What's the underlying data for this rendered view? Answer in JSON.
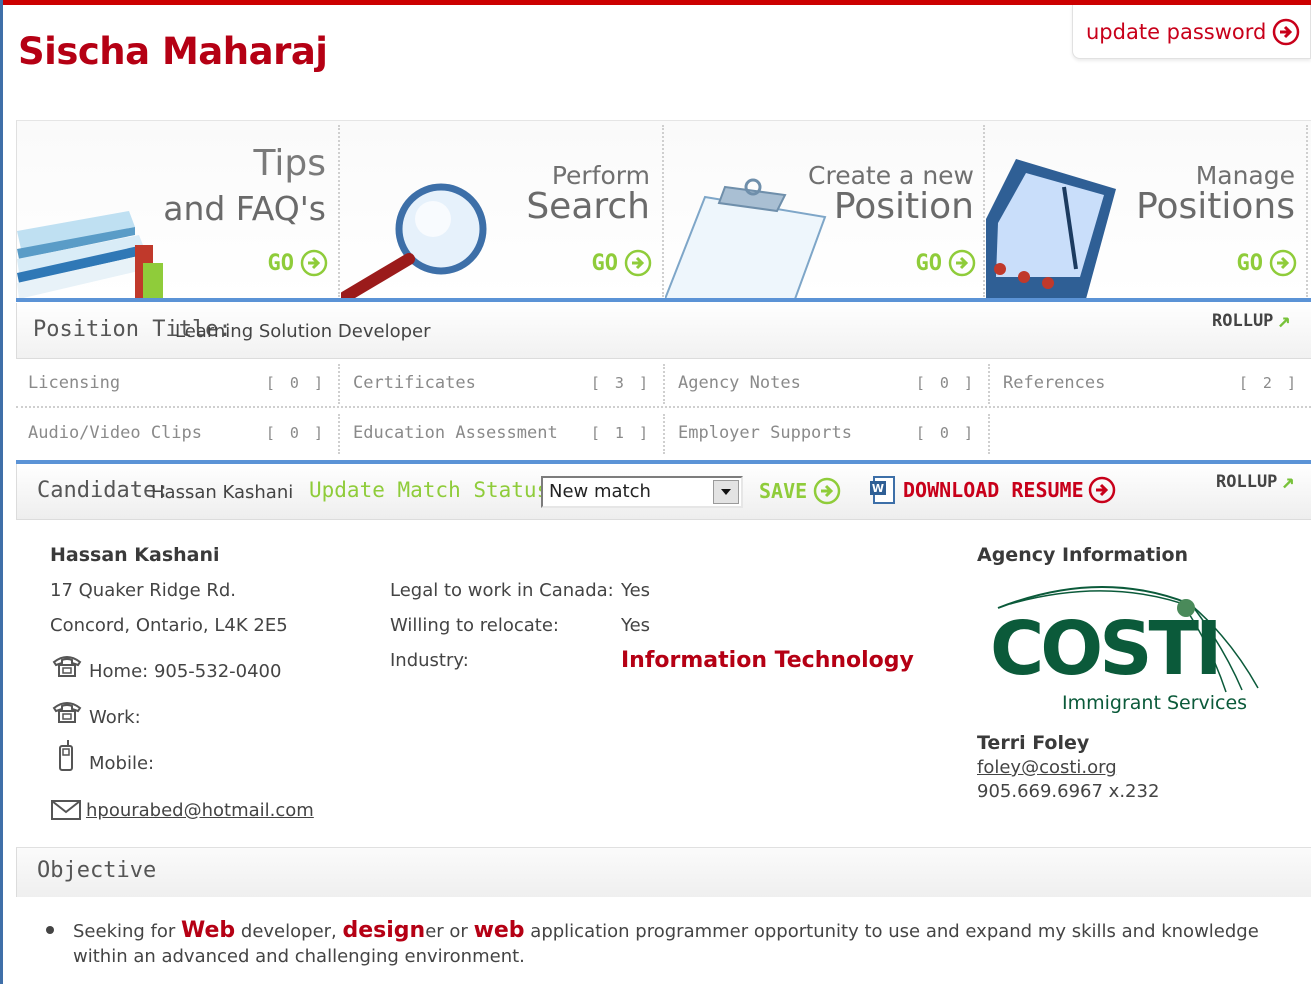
{
  "header": {
    "user_name": "Sischa Maharaj",
    "update_password": "update password"
  },
  "banner": {
    "tiles": [
      {
        "small": "Tips",
        "big": "and FAQ's",
        "go": "GO"
      },
      {
        "small": "Perform",
        "big": "Search",
        "go": "GO"
      },
      {
        "small": "Create a new",
        "big": "Position",
        "go": "GO"
      },
      {
        "small": "Manage",
        "big": "Positions",
        "go": "GO"
      }
    ]
  },
  "position": {
    "label": "Position Title:",
    "value": "Learning Solution Developer",
    "rollup": "ROLLUP"
  },
  "sections": {
    "row1": [
      {
        "label": "Licensing",
        "count": "[ 0 ]"
      },
      {
        "label": "Certificates",
        "count": "[ 3 ]"
      },
      {
        "label": "Agency Notes",
        "count": "[ 0 ]"
      },
      {
        "label": "References",
        "count": "[ 2 ]"
      }
    ],
    "row2": [
      {
        "label": "Audio/Video Clips",
        "count": "[ 0 ]"
      },
      {
        "label": "Education Assessment",
        "count": "[ 1 ]"
      },
      {
        "label": "Employer Supports",
        "count": "[ 0 ]"
      }
    ]
  },
  "candidate_bar": {
    "label": "Candidate:",
    "name": "Hassan Kashani",
    "update_status_label": "Update Match Status:",
    "status_selected": "New match",
    "save": "SAVE",
    "download_resume": "DOWNLOAD RESUME",
    "rollup": "ROLLUP"
  },
  "candidate": {
    "name": "Hassan Kashani",
    "address1": "17 Quaker Ridge Rd.",
    "address2": "Concord, Ontario, L4K 2E5",
    "home": "Home: 905-532-0400",
    "work": "Work:",
    "mobile": "Mobile:",
    "email": "hpourabed@hotmail.com",
    "legal_label": "Legal to work in Canada:",
    "legal_value": "Yes",
    "relocate_label": "Willing to relocate:",
    "relocate_value": "Yes",
    "industry_label": "Industry:",
    "industry_value": "Information Technology"
  },
  "agency": {
    "heading": "Agency Information",
    "logo_text": "COSTI",
    "logo_sub": "Immigrant Services",
    "contact_name": "Terri Foley",
    "contact_email": "foley@costi.org",
    "contact_phone": "905.669.6967 x.232"
  },
  "objective": {
    "heading": "Objective",
    "p1": "Seeking for ",
    "h1": "Web",
    "p2": " developer, ",
    "h2": "design",
    "p3": "er or ",
    "h3": "web",
    "p4": " application programmer opportunity to use and expand my skills and knowledge within an advanced and challenging environment."
  },
  "colors": {
    "brand_red": "#b50014",
    "accent_green": "#8fcc3a",
    "accent_blue": "#5b93d6",
    "costi_green": "#0b5a3a"
  }
}
